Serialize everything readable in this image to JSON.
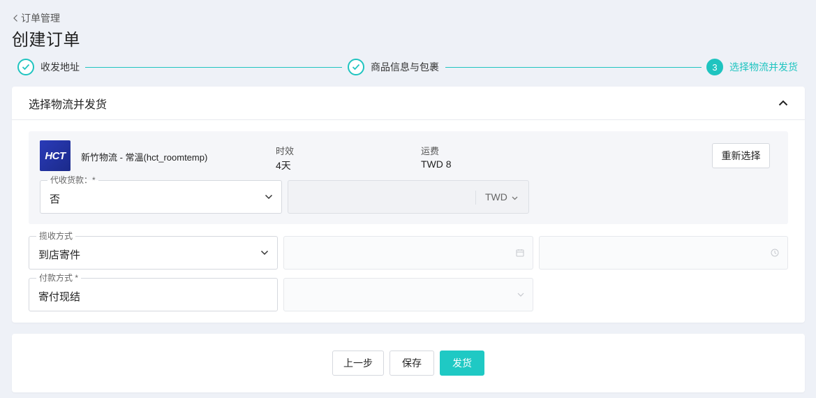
{
  "header": {
    "back_label": "订单管理",
    "title": "创建订单"
  },
  "steps": [
    {
      "label": "收发地址",
      "status": "done"
    },
    {
      "label": "商品信息与包裹",
      "status": "done"
    },
    {
      "number": "3",
      "label": "选择物流并发货",
      "status": "active"
    }
  ],
  "section": {
    "title": "选择物流并发货"
  },
  "carrier": {
    "logo_text": "HCT",
    "name": "新竹物流 - 常溫(hct_roomtemp)",
    "eta_label": "时效",
    "eta_value": "4天",
    "fee_label": "运费",
    "fee_value": "TWD 8",
    "reselect_label": "重新选择"
  },
  "cod": {
    "label": "代收货款：*",
    "value": "否",
    "amount_value": "",
    "currency": "TWD"
  },
  "pickup": {
    "label": "揽收方式",
    "value": "到店寄件",
    "date_value": "",
    "time_value": ""
  },
  "payment": {
    "label": "付款方式 *",
    "value": "寄付现结",
    "extra_value": ""
  },
  "actions": {
    "prev_label": "上一步",
    "save_label": "保存",
    "ship_label": "发货"
  },
  "colors": {
    "accent": "#1fc9c4",
    "background": "#eef1f7"
  }
}
